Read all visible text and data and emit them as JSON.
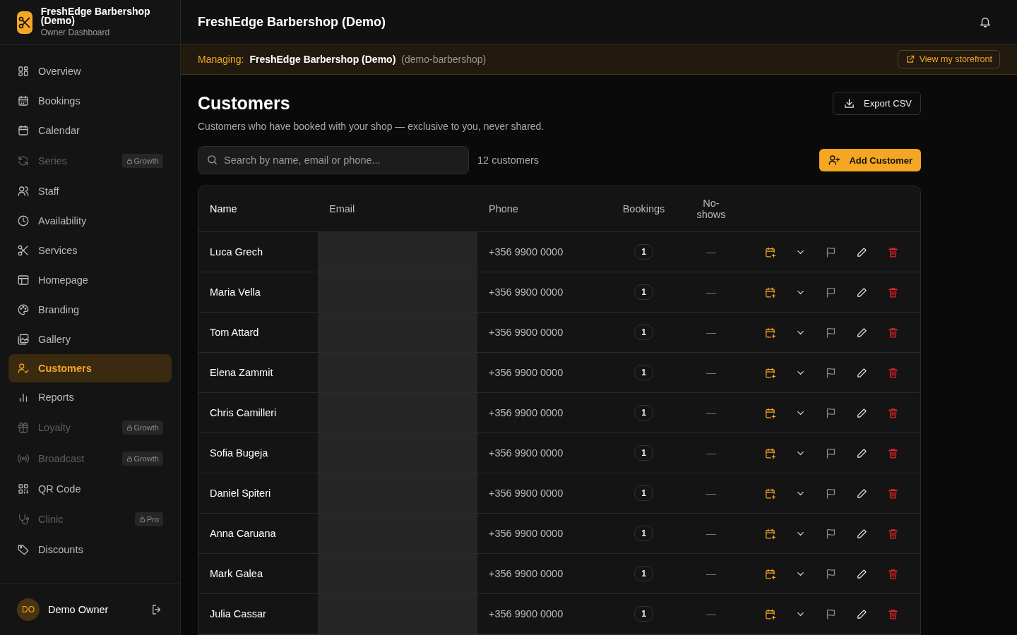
{
  "brand": {
    "name": "FreshEdge Barbershop (Demo)",
    "subtitle": "Owner Dashboard"
  },
  "sidebar": {
    "items": [
      {
        "label": "Overview",
        "selected": false,
        "locked": false
      },
      {
        "label": "Bookings",
        "selected": false,
        "locked": false
      },
      {
        "label": "Calendar",
        "selected": false,
        "locked": false
      },
      {
        "label": "Series",
        "selected": false,
        "locked": true,
        "badge": "Growth"
      },
      {
        "label": "Staff",
        "selected": false,
        "locked": false
      },
      {
        "label": "Availability",
        "selected": false,
        "locked": false
      },
      {
        "label": "Services",
        "selected": false,
        "locked": false
      },
      {
        "label": "Homepage",
        "selected": false,
        "locked": false
      },
      {
        "label": "Branding",
        "selected": false,
        "locked": false
      },
      {
        "label": "Gallery",
        "selected": false,
        "locked": false
      },
      {
        "label": "Customers",
        "selected": true,
        "locked": false
      },
      {
        "label": "Reports",
        "selected": false,
        "locked": false
      },
      {
        "label": "Loyalty",
        "selected": false,
        "locked": true,
        "badge": "Growth"
      },
      {
        "label": "Broadcast",
        "selected": false,
        "locked": true,
        "badge": "Growth"
      },
      {
        "label": "QR Code",
        "selected": false,
        "locked": false
      },
      {
        "label": "Clinic",
        "selected": false,
        "locked": true,
        "badge": "Pro"
      },
      {
        "label": "Discounts",
        "selected": false,
        "locked": false
      }
    ],
    "user": {
      "initials": "DO",
      "name": "Demo Owner"
    }
  },
  "header": {
    "title": "FreshEdge Barbershop (Demo)"
  },
  "managing_bar": {
    "label": "Managing:",
    "shop": "FreshEdge Barbershop (Demo)",
    "slug": "(demo-barbershop)",
    "link": "View my storefront"
  },
  "page": {
    "title": "Customers",
    "subtitle": "Customers who have booked with your shop — exclusive to you, never shared.",
    "export_button": "Export CSV",
    "search": {
      "placeholder": "Search by name, email or phone..."
    },
    "count": "12 customers",
    "add_button": "Add Customer"
  },
  "table": {
    "columns": [
      "Name",
      "Email",
      "Phone",
      "Bookings",
      "No-shows"
    ],
    "rows": [
      {
        "name": "Luca Grech",
        "phone": "+356 9900 0000",
        "bookings": "1",
        "no_shows": "—"
      },
      {
        "name": "Maria Vella",
        "phone": "+356 9900 0000",
        "bookings": "1",
        "no_shows": "—"
      },
      {
        "name": "Tom Attard",
        "phone": "+356 9900 0000",
        "bookings": "1",
        "no_shows": "—"
      },
      {
        "name": "Elena Zammit",
        "phone": "+356 9900 0000",
        "bookings": "1",
        "no_shows": "—"
      },
      {
        "name": "Chris Camilleri",
        "phone": "+356 9900 0000",
        "bookings": "1",
        "no_shows": "—"
      },
      {
        "name": "Sofia Bugeja",
        "phone": "+356 9900 0000",
        "bookings": "1",
        "no_shows": "—"
      },
      {
        "name": "Daniel Spiteri",
        "phone": "+356 9900 0000",
        "bookings": "1",
        "no_shows": "—"
      },
      {
        "name": "Anna Caruana",
        "phone": "+356 9900 0000",
        "bookings": "1",
        "no_shows": "—"
      },
      {
        "name": "Mark Galea",
        "phone": "+356 9900 0000",
        "bookings": "1",
        "no_shows": "—"
      },
      {
        "name": "Julia Cassar",
        "phone": "+356 9900 0000",
        "bookings": "1",
        "no_shows": "—"
      }
    ]
  }
}
